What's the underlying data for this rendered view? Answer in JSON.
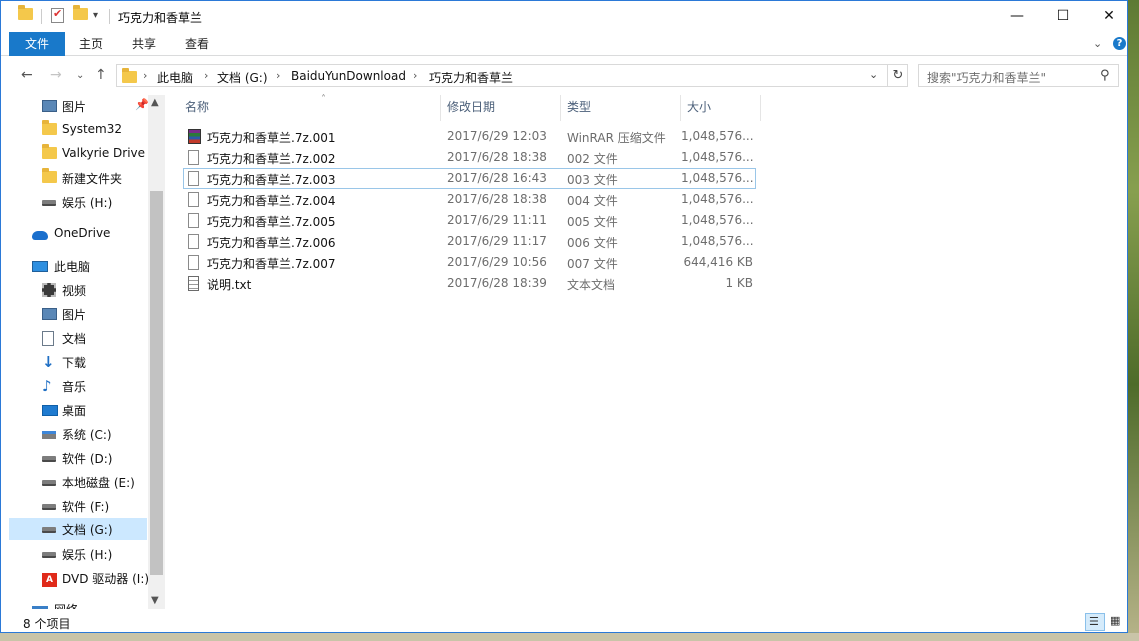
{
  "window": {
    "title": "巧克力和香草兰",
    "controls": {
      "minimize": "—",
      "maximize": "☐",
      "close": "✕"
    }
  },
  "ribbon": {
    "tabs": [
      "文件",
      "主页",
      "共享",
      "查看"
    ],
    "expand_glyph": "⌄",
    "help_glyph": "?"
  },
  "nav": {
    "back_glyph": "←",
    "forward_glyph": "→",
    "recent_glyph": "⌄",
    "up_glyph": "↑",
    "breadcrumb": [
      "此电脑",
      "文档 (G:)",
      "BaiduYunDownload",
      "巧克力和香草兰"
    ],
    "crumb_sep": "›",
    "dropdown_glyph": "⌄",
    "refresh_glyph": "↻"
  },
  "search": {
    "placeholder": "搜索\"巧克力和香草兰\"",
    "icon": "search-icon",
    "icon_glyph": "⚲"
  },
  "navpane": {
    "items": [
      {
        "label": "图片",
        "icon": "pictures-icon",
        "pinned": true
      },
      {
        "label": "System32",
        "icon": "folder-icon"
      },
      {
        "label": "Valkyrie Drive",
        "icon": "folder-icon"
      },
      {
        "label": "新建文件夹",
        "icon": "folder-icon"
      },
      {
        "label": "娱乐 (H:)",
        "icon": "drive-icon"
      },
      {
        "label": "OneDrive",
        "icon": "onedrive-icon"
      },
      {
        "label": "此电脑",
        "icon": "this-pc-icon"
      },
      {
        "label": "视频",
        "icon": "videos-icon"
      },
      {
        "label": "图片",
        "icon": "pictures-icon"
      },
      {
        "label": "文档",
        "icon": "documents-icon"
      },
      {
        "label": "下载",
        "icon": "downloads-icon"
      },
      {
        "label": "音乐",
        "icon": "music-icon"
      },
      {
        "label": "桌面",
        "icon": "desktop-icon"
      },
      {
        "label": "系统 (C:)",
        "icon": "system-drive-icon"
      },
      {
        "label": "软件 (D:)",
        "icon": "drive-icon"
      },
      {
        "label": "本地磁盘 (E:)",
        "icon": "drive-icon"
      },
      {
        "label": "软件 (F:)",
        "icon": "drive-icon"
      },
      {
        "label": "文档 (G:)",
        "icon": "drive-icon",
        "selected": true
      },
      {
        "label": "娱乐 (H:)",
        "icon": "drive-icon"
      },
      {
        "label": "DVD 驱动器 (I:)",
        "icon": "dvd-drive-icon"
      },
      {
        "label": "网络",
        "icon": "network-icon"
      }
    ],
    "pin_glyph": "📌",
    "scroll_up_glyph": "▲",
    "scroll_down_glyph": "▼"
  },
  "filelist": {
    "sort_glyph": "˄",
    "columns": {
      "name": "名称",
      "date": "修改日期",
      "type": "类型",
      "size": "大小"
    },
    "rows": [
      {
        "name": "巧克力和香草兰.7z.001",
        "date": "2017/6/29 12:03",
        "type": "WinRAR 压缩文件",
        "size": "1,048,576...",
        "icon": "winrar-archive-icon"
      },
      {
        "name": "巧克力和香草兰.7z.002",
        "date": "2017/6/28 18:38",
        "type": "002 文件",
        "size": "1,048,576...",
        "icon": "file-icon"
      },
      {
        "name": "巧克力和香草兰.7z.003",
        "date": "2017/6/28 16:43",
        "type": "003 文件",
        "size": "1,048,576...",
        "icon": "file-icon",
        "focused": true
      },
      {
        "name": "巧克力和香草兰.7z.004",
        "date": "2017/6/28 18:38",
        "type": "004 文件",
        "size": "1,048,576...",
        "icon": "file-icon"
      },
      {
        "name": "巧克力和香草兰.7z.005",
        "date": "2017/6/29 11:11",
        "type": "005 文件",
        "size": "1,048,576...",
        "icon": "file-icon"
      },
      {
        "name": "巧克力和香草兰.7z.006",
        "date": "2017/6/29 11:17",
        "type": "006 文件",
        "size": "1,048,576...",
        "icon": "file-icon"
      },
      {
        "name": "巧克力和香草兰.7z.007",
        "date": "2017/6/29 10:56",
        "type": "007 文件",
        "size": "644,416 KB",
        "icon": "file-icon"
      },
      {
        "name": "说明.txt",
        "date": "2017/6/28 18:39",
        "type": "文本文档",
        "size": "1 KB",
        "icon": "text-file-icon"
      }
    ]
  },
  "status": {
    "item_count": "8 个项目",
    "details_glyph": "☰",
    "large_icons_glyph": "▦"
  }
}
